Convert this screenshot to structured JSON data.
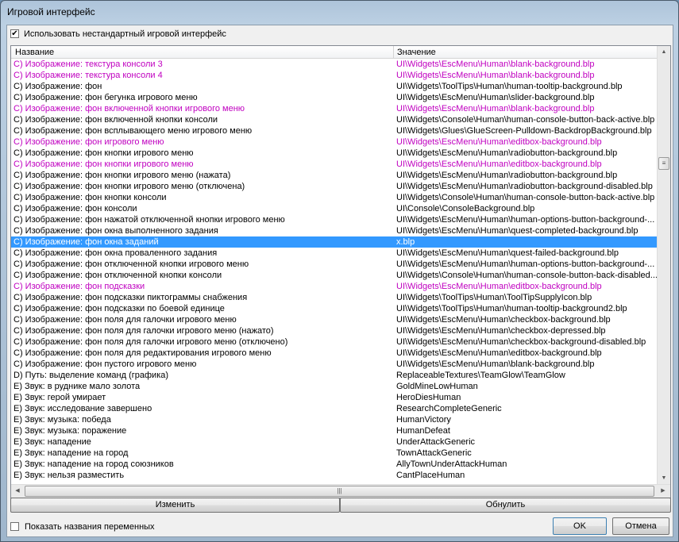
{
  "window": {
    "title": "Игровой интерфейс"
  },
  "use_custom": {
    "label": "Использовать нестандартный игровой интерфейс",
    "checked": true
  },
  "columns": {
    "name": "Название",
    "value": "Значение"
  },
  "rows": [
    {
      "name": "C) Изображение: текстура консоли 3",
      "value": "UI\\Widgets\\EscMenu\\Human\\blank-background.blp",
      "modified": true
    },
    {
      "name": "C) Изображение: текстура консоли 4",
      "value": "UI\\Widgets\\EscMenu\\Human\\blank-background.blp",
      "modified": true
    },
    {
      "name": "C) Изображение: фон",
      "value": "UI\\Widgets\\ToolTips\\Human\\human-tooltip-background.blp"
    },
    {
      "name": "C) Изображение: фон бегунка игрового меню",
      "value": "UI\\Widgets\\EscMenu\\Human\\slider-background.blp"
    },
    {
      "name": "C) Изображение: фон включенной кнопки игрового меню",
      "value": "UI\\Widgets\\EscMenu\\Human\\blank-background.blp",
      "modified": true
    },
    {
      "name": "C) Изображение: фон включенной кнопки консоли",
      "value": "UI\\Widgets\\Console\\Human\\human-console-button-back-active.blp"
    },
    {
      "name": "C) Изображение: фон всплывающего меню игрового меню",
      "value": "UI\\Widgets\\Glues\\GlueScreen-Pulldown-BackdropBackground.blp"
    },
    {
      "name": "C) Изображение: фон игрового меню",
      "value": "UI\\Widgets\\EscMenu\\Human\\editbox-background.blp",
      "modified": true
    },
    {
      "name": "C) Изображение: фон кнопки игрового меню",
      "value": "UI\\Widgets\\EscMenu\\Human\\radiobutton-background.blp"
    },
    {
      "name": "C) Изображение: фон кнопки игрового меню",
      "value": "UI\\Widgets\\EscMenu\\Human\\editbox-background.blp",
      "modified": true
    },
    {
      "name": "C) Изображение: фон кнопки игрового меню (нажата)",
      "value": "UI\\Widgets\\EscMenu\\Human\\radiobutton-background.blp"
    },
    {
      "name": "C) Изображение: фон кнопки игрового меню (отключена)",
      "value": "UI\\Widgets\\EscMenu\\Human\\radiobutton-background-disabled.blp"
    },
    {
      "name": "C) Изображение: фон кнопки консоли",
      "value": "UI\\Widgets\\Console\\Human\\human-console-button-back-active.blp"
    },
    {
      "name": "C) Изображение: фон консоли",
      "value": "UI\\Console\\ConsoleBackground.blp"
    },
    {
      "name": "C) Изображение: фон нажатой отключенной кнопки игрового меню",
      "value": "UI\\Widgets\\EscMenu\\Human\\human-options-button-background-..."
    },
    {
      "name": "C) Изображение: фон окна выполненного задания",
      "value": "UI\\Widgets\\EscMenu\\Human\\quest-completed-background.blp"
    },
    {
      "name": "C) Изображение: фон окна заданий",
      "value": "x.blp",
      "selected": true
    },
    {
      "name": "C) Изображение: фон окна проваленного задания",
      "value": "UI\\Widgets\\EscMenu\\Human\\quest-failed-background.blp"
    },
    {
      "name": "C) Изображение: фон отключенной кнопки игрового меню",
      "value": "UI\\Widgets\\EscMenu\\Human\\human-options-button-background-..."
    },
    {
      "name": "C) Изображение: фон отключенной кнопки консоли",
      "value": "UI\\Widgets\\Console\\Human\\human-console-button-back-disabled..."
    },
    {
      "name": "C) Изображение: фон подсказки",
      "value": "UI\\Widgets\\EscMenu\\Human\\editbox-background.blp",
      "modified": true
    },
    {
      "name": "C) Изображение: фон подсказки пиктограммы снабжения",
      "value": "UI\\Widgets\\ToolTips\\Human\\ToolTipSupplyIcon.blp"
    },
    {
      "name": "C) Изображение: фон подсказки по боевой единице",
      "value": "UI\\Widgets\\ToolTips\\Human\\human-tooltip-background2.blp"
    },
    {
      "name": "C) Изображение: фон поля для галочки игрового меню",
      "value": "UI\\Widgets\\EscMenu\\Human\\checkbox-background.blp"
    },
    {
      "name": "C) Изображение: фон поля для галочки игрового меню (нажато)",
      "value": "UI\\Widgets\\EscMenu\\Human\\checkbox-depressed.blp"
    },
    {
      "name": "C) Изображение: фон поля для галочки игрового меню (отключено)",
      "value": "UI\\Widgets\\EscMenu\\Human\\checkbox-background-disabled.blp"
    },
    {
      "name": "C) Изображение: фон поля для редактирования игрового меню",
      "value": "UI\\Widgets\\EscMenu\\Human\\editbox-background.blp"
    },
    {
      "name": "C) Изображение: фон пустого игрового меню",
      "value": "UI\\Widgets\\EscMenu\\Human\\blank-background.blp"
    },
    {
      "name": "D) Путь: выделение команд (графика)",
      "value": "ReplaceableTextures\\TeamGlow\\TeamGlow"
    },
    {
      "name": "E) Звук: в руднике мало золота",
      "value": "GoldMineLowHuman"
    },
    {
      "name": "E) Звук: герой умирает",
      "value": "HeroDiesHuman"
    },
    {
      "name": "E) Звук: исследование завершено",
      "value": "ResearchCompleteGeneric"
    },
    {
      "name": "E) Звук: музыка: победа",
      "value": "HumanVictory"
    },
    {
      "name": "E) Звук: музыка: поражение",
      "value": "HumanDefeat"
    },
    {
      "name": "E) Звук: нападение",
      "value": "UnderAttackGeneric"
    },
    {
      "name": "E) Звук: нападение на город",
      "value": "TownAttackGeneric"
    },
    {
      "name": "E) Звук: нападение на город союзников",
      "value": "AllyTownUnderAttackHuman"
    },
    {
      "name": "E) Звук: нельзя разместить",
      "value": "CantPlaceHuman"
    }
  ],
  "buttons": {
    "edit": "Изменить",
    "reset": "Обнулить",
    "ok": "OK",
    "cancel": "Отмена"
  },
  "show_var_names": {
    "label": "Показать названия переменных",
    "checked": false
  },
  "colors": {
    "modified": "#c000c0",
    "selection": "#3399ff"
  }
}
